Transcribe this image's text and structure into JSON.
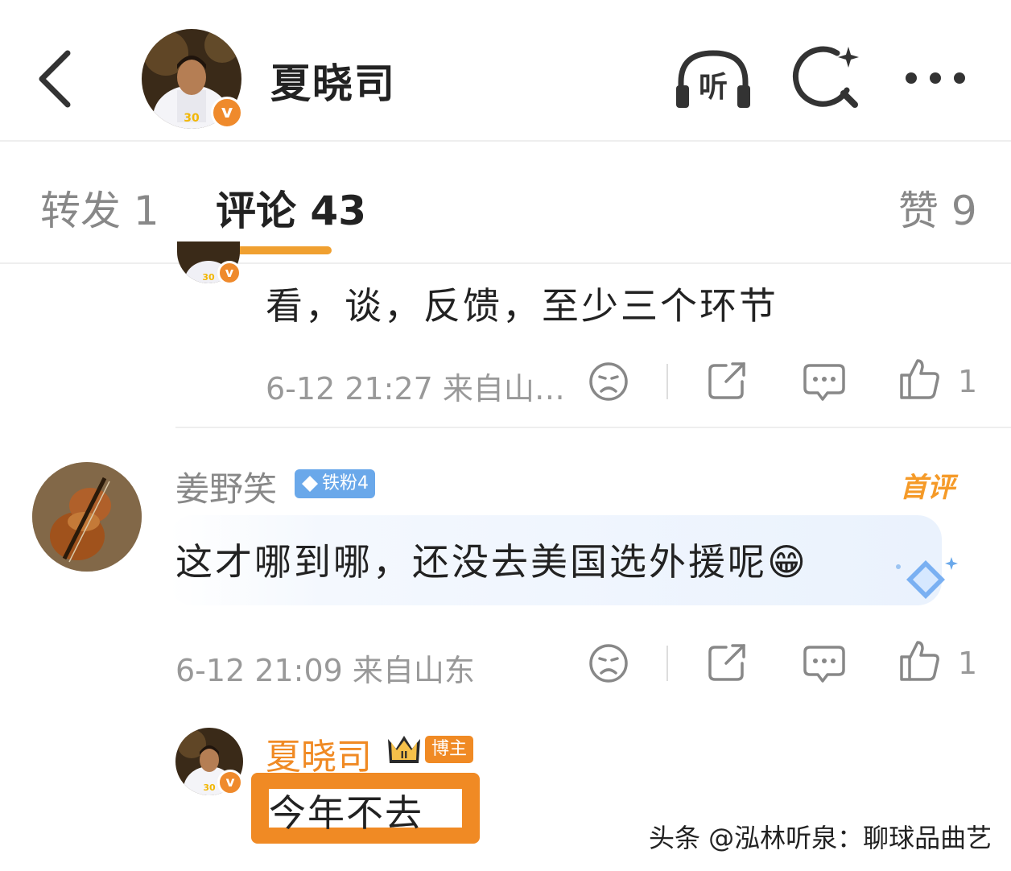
{
  "header": {
    "title": "夏晓司",
    "listen_label": "听",
    "icons": [
      "back-icon",
      "listen-headphones-icon",
      "search-sparkle-icon",
      "more-icon"
    ]
  },
  "tabs": [
    {
      "label": "转发 1",
      "active": false
    },
    {
      "label": "评论 43",
      "active": true
    },
    {
      "label": "赞 9",
      "active": false
    }
  ],
  "comments": [
    {
      "text": "看，谈，反馈，至少三个环节",
      "meta": "6-12 21:27  来自山…",
      "likes": "1"
    },
    {
      "username": "姜野笑",
      "fan_badge": "铁粉4",
      "first_badge": "首评",
      "text": "这才哪到哪，还没去美国选外援呢",
      "emoji": "😁",
      "meta": "6-12 21:09  来自山东",
      "likes": "1"
    }
  ],
  "reply": {
    "username": "夏晓司",
    "owner_badge": "博主",
    "text": "今年不去"
  },
  "watermark": "头条 @泓林听泉：聊球品曲艺",
  "colors": {
    "accent_orange": "#f08a24",
    "tab_underline": "#f0a030",
    "fan_badge_blue": "#6aa8ea",
    "meta_gray": "#999999"
  }
}
